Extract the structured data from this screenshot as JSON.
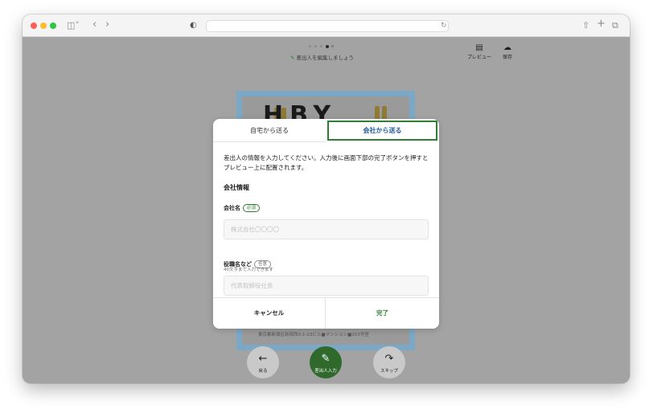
{
  "browser": {
    "traffic_lights": [
      "#ff5f57",
      "#febc2e",
      "#28c840"
    ],
    "icons": {
      "sidebar": "sidebar-icon",
      "back": "chevron-left-icon",
      "forward": "chevron-right-icon",
      "privacy": "privacy-shield-icon",
      "reload": "reload-icon",
      "share": "share-icon",
      "new_tab": "plus-icon",
      "tabs": "tab-overview-icon"
    }
  },
  "editor": {
    "step_total": 5,
    "step_current": 4,
    "edit_hint": "差出人を編集しましょう",
    "preview_label": "プレビュー",
    "save_label": "保存",
    "card_greeting": "HBY",
    "card_footer": "東京都新宿区新宿西0-1-23ビル■マンション■203号室",
    "back_label": "戻る",
    "sender_input_label": "差出人入力",
    "skip_label": "スキップ"
  },
  "modal": {
    "tabs": [
      {
        "label": "自宅から送る",
        "active": false
      },
      {
        "label": "会社から送る",
        "active": true
      }
    ],
    "description": "差出人の情報を入力してください。入力後に画面下部の完了ボタンを押すとプレビュー上に配置されます。",
    "section_title": "会社情報",
    "fields": [
      {
        "label": "会社名",
        "badge": "必須",
        "placeholder": "株式会社〇〇〇〇",
        "value": "",
        "help": "40文字まで入力できます"
      },
      {
        "label": "役職名など",
        "badge": "任意",
        "placeholder": "代表取締役社長",
        "value": ""
      }
    ],
    "cancel_label": "キャンセル",
    "done_label": "完了"
  },
  "colors": {
    "accent_green": "#2e7d32",
    "primary_button": "#2f6a2c",
    "active_tab_text": "#1f5a99",
    "overlay": "#a3a3a3",
    "card_frame": "#7ba8c7"
  }
}
